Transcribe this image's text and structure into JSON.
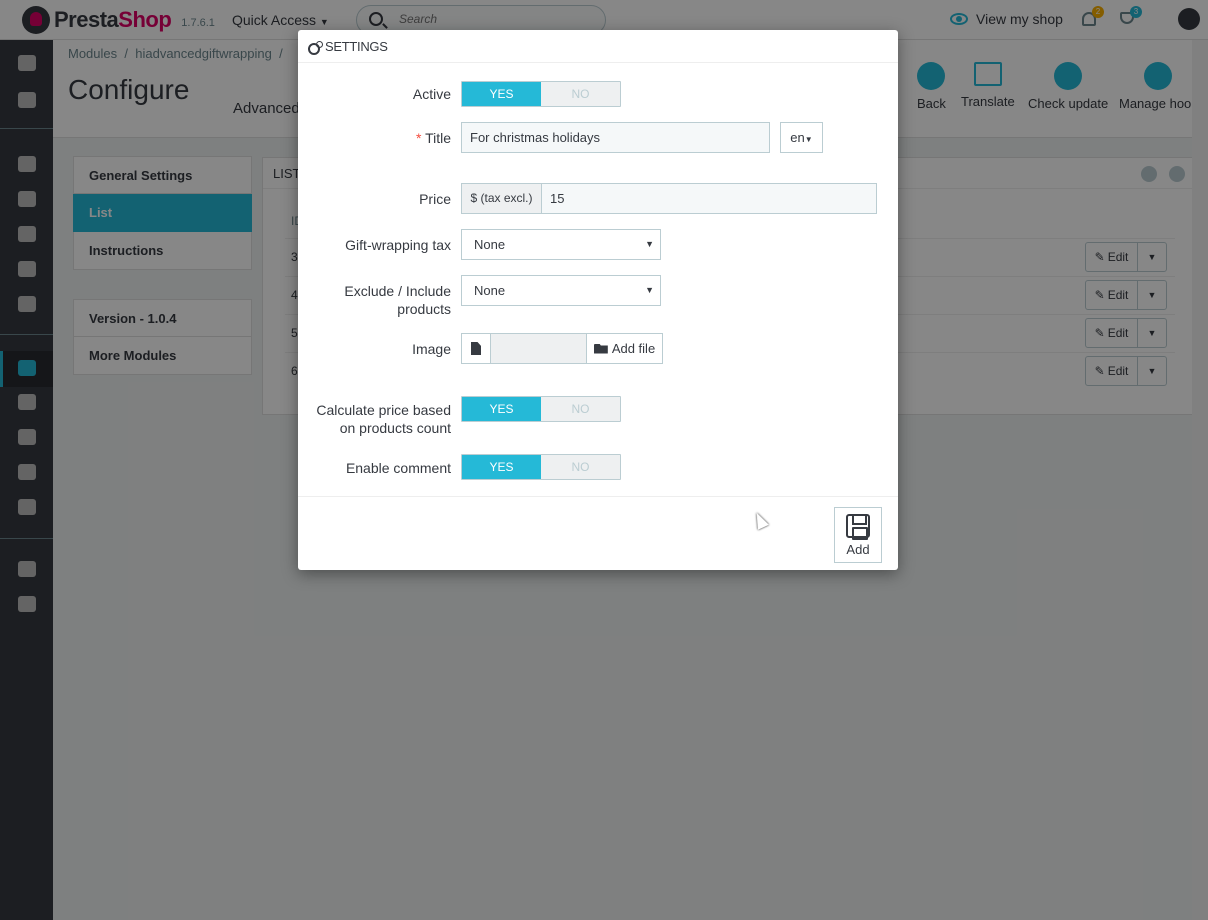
{
  "topbar": {
    "logo_text": "Presta",
    "logo_text_accent": "Shop",
    "version": "1.7.6.1",
    "quick_access": "Quick Access",
    "search_placeholder": "Search",
    "view_shop": "View my shop",
    "orders_badge": "2",
    "trophy_badge": "3",
    "colors": {
      "accent": "#25b9d7",
      "brand": "#df0067"
    }
  },
  "breadcrumb": {
    "item1": "Modules",
    "sep": "/",
    "item2": "hiadvancedgiftwrapping",
    "item3": "/"
  },
  "page": {
    "title": "Configure",
    "subtitle": "Advanced"
  },
  "toolbar": {
    "back": "Back",
    "translate": "Translate",
    "check_update": "Check update",
    "manage_hooks": "Manage hook"
  },
  "left_menu": {
    "items": [
      "General Settings",
      "List",
      "Instructions"
    ],
    "active": "List",
    "version": "Version - 1.0.4",
    "more": "More Modules"
  },
  "list_panel": {
    "header": "LIST",
    "id_col": "ID",
    "rows": [
      "3",
      "4",
      "5",
      "6"
    ],
    "edit_label": "Edit"
  },
  "modal": {
    "title": "SETTINGS",
    "active_label": "Active",
    "yes": "YES",
    "no": "NO",
    "title_label": "Title",
    "required_mark": "*",
    "title_value": "For christmas holidays",
    "lang": "en",
    "price_label": "Price",
    "price_addon": "$ (tax excl.)",
    "price_value": "15",
    "tax_label": "Gift-wrapping tax",
    "tax_value": "None",
    "exclude_label_1": "Exclude / Include",
    "exclude_label_2": "products",
    "exclude_value": "None",
    "image_label": "Image",
    "add_file": "Add file",
    "calc_label_1": "Calculate price based",
    "calc_label_2": "on products count",
    "comment_label": "Enable comment",
    "add_button": "Add"
  }
}
